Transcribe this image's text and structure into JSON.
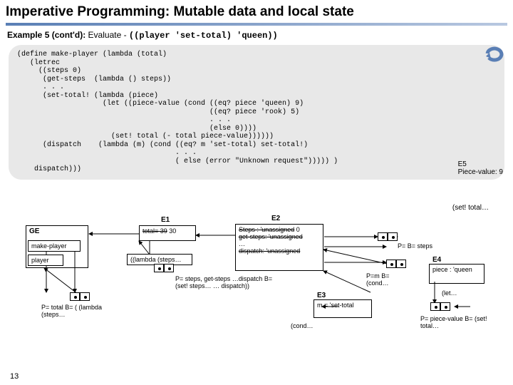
{
  "title": "Imperative Programming:   Mutable data and local state",
  "subtitle": {
    "label": "Example 5 (cont'd):",
    "text": " Evaluate -",
    "code": "((player 'set-total) 'queen))"
  },
  "code": "(define make-player (lambda (total)\n   (letrec\n     ((steps 0)\n      (get-steps  (lambda () steps))\n      . . .\n      (set-total! (lambda (piece)\n                    (let ((piece-value (cond ((eq? piece 'queen) 9)\n                                             ((eq? piece 'rook) 5)\n                                             . . .\n                                             (else 0))))\n                      (set! total (- total piece-value))))))\n      (dispatch    (lambda (m) (cond ((eq? m 'set-total) set-total!)\n                                     . . .\n                                     ( else (error \"Unknown request\"))))) )\n    dispatch)))",
  "notes": {
    "e5l1": "E5",
    "e5l2": "Piece-value: 9",
    "settotal": "(set! total…"
  },
  "diag": {
    "GE": "GE",
    "E1": "E1",
    "E2": "E2",
    "makeplayer": "make-player",
    "player": "player",
    "total_struck": "total= 39",
    "total_new": "30",
    "lambda_steps": "((lambda (steps…",
    "p_total": "P= total\nB= ( (lambda (steps…",
    "p_steps": "P= steps, get-steps …dispatch\nB= (set! steps…\n     …\n   dispatch))",
    "e2_steps_s1": "Steps : 'unassigned",
    "e2_steps_s2": "0",
    "e2_get": "get-steps: 'unassigned",
    "e2_dots": "…",
    "e2_dispatch": "dispatch: 'unassigned",
    "p_bsteps": "P=\nB= steps",
    "p_m": "P=m\nB=(cond…",
    "e3_label": "E3",
    "e3_body": "m = 'set-total",
    "e3_cond": "(cond…",
    "e4_label": "E4",
    "e4_body": "piece : 'queen",
    "e4_let": "(let…",
    "p_piece": "P= piece-value\nB= (set! total…"
  },
  "slide": "13"
}
